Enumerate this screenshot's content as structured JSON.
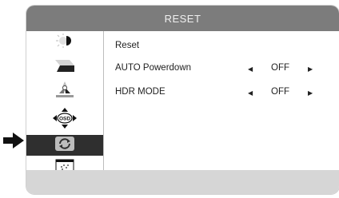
{
  "title": "RESET",
  "sidebar": {
    "items": [
      {
        "icon": "brightness-contrast-icon",
        "active": false
      },
      {
        "icon": "color-icon",
        "active": false
      },
      {
        "icon": "picture-icon",
        "active": false
      },
      {
        "icon": "osd-settings-icon",
        "active": false,
        "label": "OSD"
      },
      {
        "icon": "reset-icon",
        "active": true
      },
      {
        "icon": "info-icon",
        "active": false
      }
    ]
  },
  "menu": {
    "items": [
      {
        "label": "Reset"
      },
      {
        "label": "AUTO Powerdown",
        "value": "OFF"
      },
      {
        "label": "HDR MODE",
        "value": "OFF"
      }
    ]
  },
  "glyphs": {
    "left_arrow": "◀",
    "right_arrow": "▶"
  },
  "colors": {
    "titlebar": "#7c7c7c",
    "active_item": "#2f2f2f",
    "footer": "#d6d6d6"
  }
}
